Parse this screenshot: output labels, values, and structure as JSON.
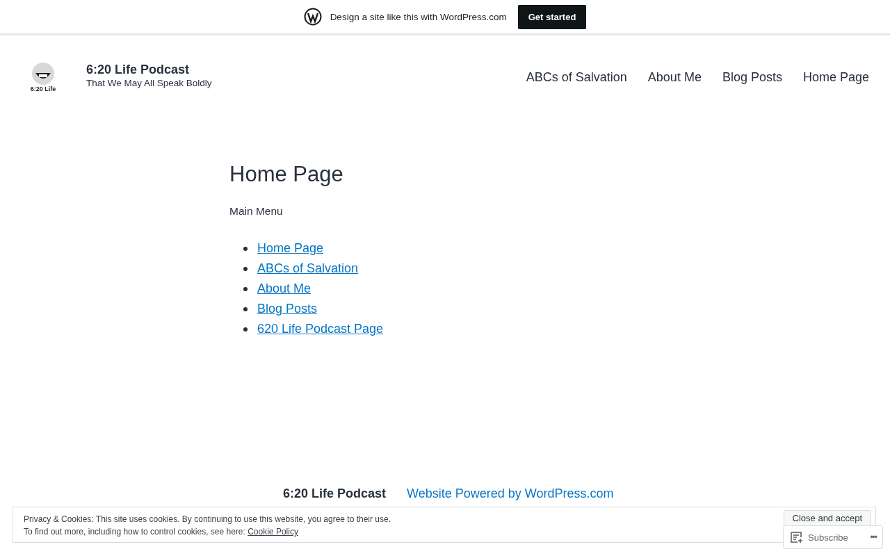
{
  "promo_bar": {
    "text": "Design a site like this with WordPress.com",
    "button": "Get started"
  },
  "header": {
    "logo_text": "6:20 Life",
    "site_title": "6:20 Life Podcast",
    "tagline": "That We May All Speak Boldly"
  },
  "nav": [
    "ABCs of Salvation",
    "About Me",
    "Blog Posts",
    "Home Page"
  ],
  "page": {
    "title": "Home Page",
    "intro": "Main Menu",
    "links": [
      "Home Page",
      "ABCs of Salvation",
      "About Me",
      "Blog Posts",
      "620 Life Podcast Page"
    ]
  },
  "footer": {
    "site_name": "6:20 Life Podcast",
    "credit": "Website Powered by WordPress.com"
  },
  "cookie_banner": {
    "line_1": "Privacy & Cookies: This site uses cookies. By continuing to use this website, you agree to their use.",
    "line_2": "To find out more, including how to control cookies, see here:",
    "link": "Cookie Policy",
    "button": "Close and accept"
  },
  "subscribe_bar": {
    "button": "Subscribe",
    "more": "•••"
  }
}
